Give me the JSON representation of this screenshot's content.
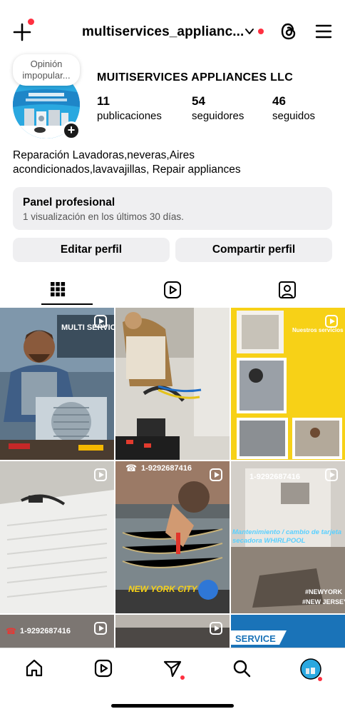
{
  "header": {
    "username": "multiservices_applianc...",
    "icons": [
      "create-plus-icon",
      "chevron-down-icon",
      "threads-icon",
      "hamburger-menu-icon"
    ]
  },
  "profile": {
    "note": "Opinión impopular...",
    "display_name": "MUITISERVICES APPLIANCES LLC",
    "stats": [
      {
        "number": "11",
        "label": "publicaciones"
      },
      {
        "number": "54",
        "label": "seguidores"
      },
      {
        "number": "46",
        "label": "seguidos"
      }
    ],
    "bio": "Reparación Lavadoras,neveras,Aires acondicionados,lavavajillas, Repair appliances"
  },
  "panel": {
    "title": "Panel profesional",
    "subtitle": "1 visualización en los últimos 30 días."
  },
  "buttons": {
    "edit": "Editar perfil",
    "share": "Compartir perfil"
  },
  "tabs": [
    "grid-icon",
    "reels-icon",
    "tagged-icon"
  ],
  "posts": [
    {
      "text": "MULTI SERVICES",
      "type": "reel"
    },
    {
      "text": "",
      "type": "post"
    },
    {
      "text": "Nuestros servicios",
      "type": "reel"
    },
    {
      "text": "",
      "type": "reel"
    },
    {
      "text": "1-9292687416",
      "text2": "NEW YORK CITY",
      "type": "reel"
    },
    {
      "text": "1-9292687416",
      "text2": "Mantenimiento / cambio de tarjeta secadora WHIRLPOOL",
      "text3": "#NEWYORK",
      "text4": "#NEW JERSEY",
      "type": "reel"
    },
    {
      "text": "1-9292687416",
      "type": "reel"
    },
    {
      "text": "",
      "type": "reel"
    },
    {
      "text": "SERVICE",
      "type": "post"
    }
  ],
  "colors": {
    "accent_red": "#ff3040",
    "panel_bg": "#efeff1",
    "yellow_post": "#f7d117"
  }
}
